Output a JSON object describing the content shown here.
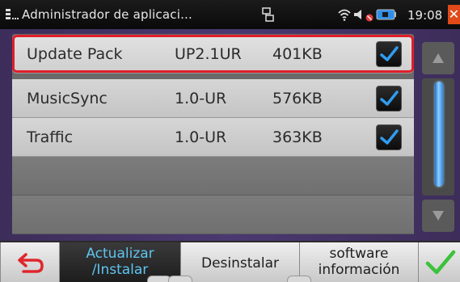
{
  "statusbar": {
    "title": "Administrador de aplicaci...",
    "time": "19:08",
    "close_label": "✕",
    "icons": [
      "app-menu-icon",
      "network-icon",
      "wifi-icon",
      "speaker-icon",
      "mute-icon",
      "battery-icon",
      "close-icon"
    ]
  },
  "packages": [
    {
      "name": "Update Pack",
      "version": "UP2.1UR",
      "size": "401KB",
      "checked": true,
      "selected": true
    },
    {
      "name": "MusicSync",
      "version": "1.0-UR",
      "size": "576KB",
      "checked": true,
      "selected": false
    },
    {
      "name": "Traffic",
      "version": "1.0-UR",
      "size": "363KB",
      "checked": true,
      "selected": false
    }
  ],
  "toolbar": {
    "back_icon": "back-arrow-icon",
    "update_line1": "Actualizar",
    "update_line2": "/Instalar",
    "uninstall": "Desinstalar",
    "info_line1": "software",
    "info_line2": "información",
    "ok_icon": "checkmark-icon",
    "active_tab": "update"
  },
  "colors": {
    "accent_blue": "#2a86ea",
    "selection_red": "#e01e2a",
    "active_text": "#5ec5f0",
    "ok_green": "#3cc23c"
  }
}
